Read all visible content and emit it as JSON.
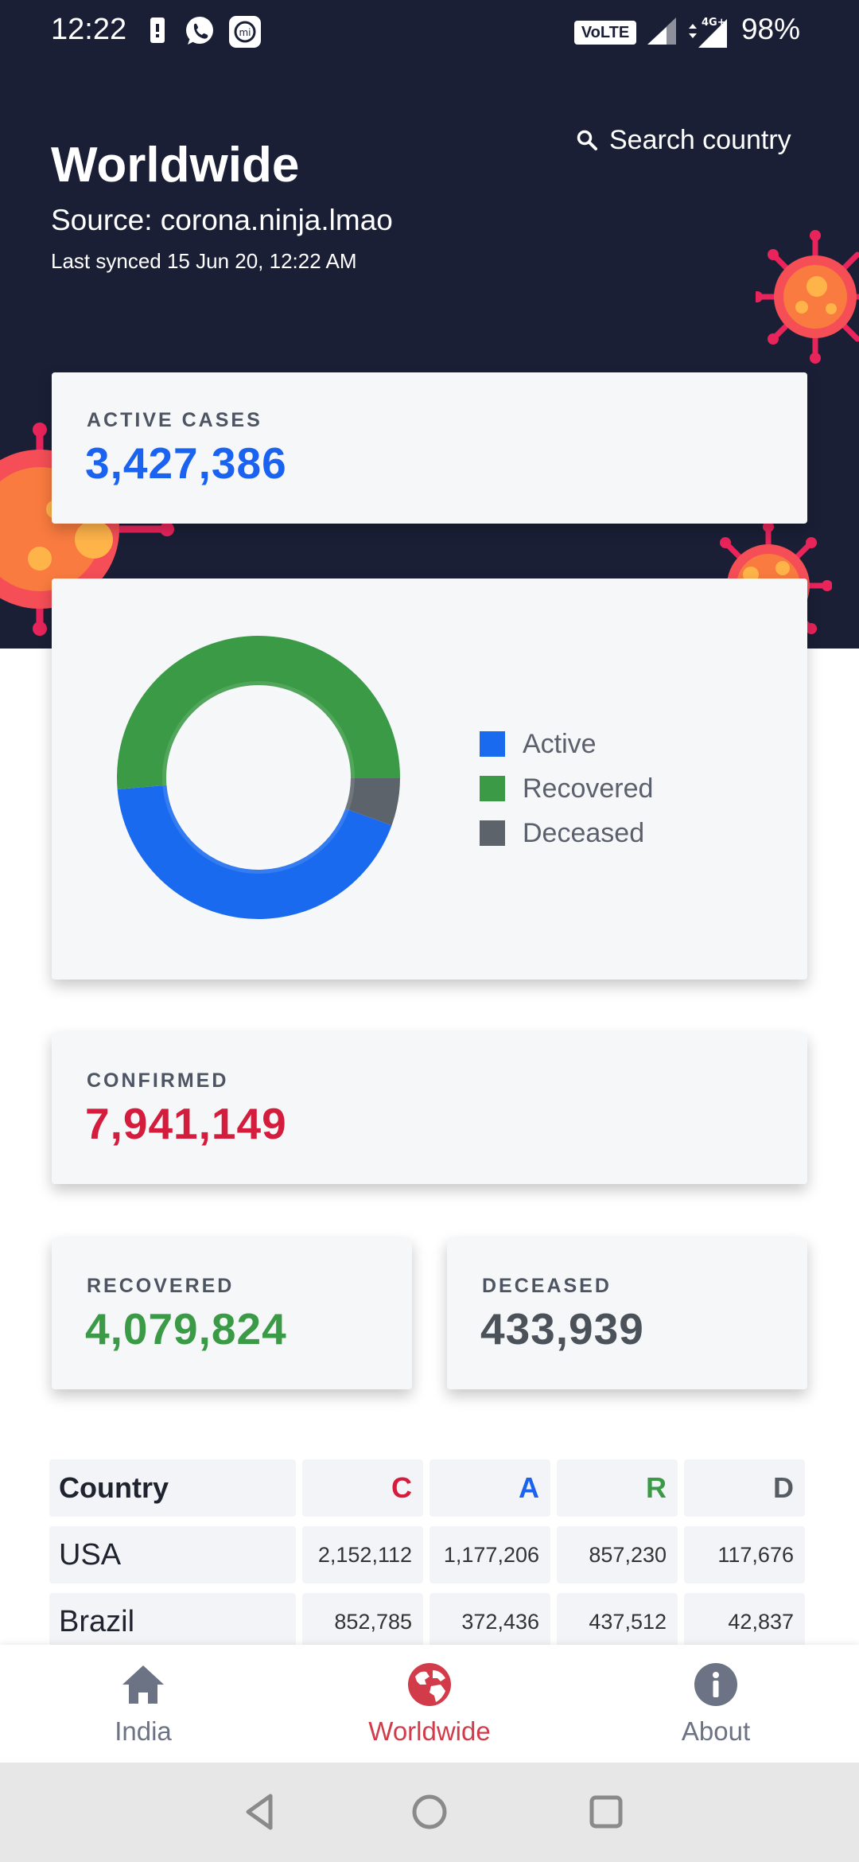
{
  "status_bar": {
    "time": "12:22",
    "network_badge": "VoLTE",
    "network_type": "4G+",
    "battery": "98%"
  },
  "header": {
    "title": "Worldwide",
    "source": "Source: corona.ninja.lmao",
    "last_synced": "Last synced 15 Jun 20, 12:22 AM",
    "search_label": "Search country"
  },
  "active_cases": {
    "label": "ACTIVE CASES",
    "value": "3,427,386",
    "color": "#1a62f0"
  },
  "chart_data": {
    "type": "pie",
    "variant": "donut",
    "categories": [
      "Active",
      "Recovered",
      "Deceased"
    ],
    "values": [
      3427386,
      4079824,
      433939
    ],
    "colors": [
      "#1a6af0",
      "#3a9a45",
      "#5c636b"
    ],
    "legend_position": "right"
  },
  "confirmed": {
    "label": "CONFIRMED",
    "value": "7,941,149",
    "color": "#d41c3d"
  },
  "recovered": {
    "label": "RECOVERED",
    "value": "4,079,824",
    "color": "#3a9a45"
  },
  "deceased": {
    "label": "DECEASED",
    "value": "433,939",
    "color": "#4b5259"
  },
  "table": {
    "headers": [
      {
        "label": "Country",
        "color": "#1f2330"
      },
      {
        "label": "C",
        "color": "#d41c3d"
      },
      {
        "label": "A",
        "color": "#1a62f0"
      },
      {
        "label": "R",
        "color": "#3a9a45"
      },
      {
        "label": "D",
        "color": "#555c63"
      }
    ],
    "rows": [
      {
        "country": "USA",
        "c": "2,152,112",
        "a": "1,177,206",
        "r": "857,230",
        "d": "117,676"
      },
      {
        "country": "Brazil",
        "c": "852,785",
        "a": "372,436",
        "r": "437,512",
        "d": "42,837"
      }
    ]
  },
  "bottom_nav": {
    "items": [
      {
        "label": "India",
        "icon": "home-icon",
        "active": false
      },
      {
        "label": "Worldwide",
        "icon": "globe-icon",
        "active": true
      },
      {
        "label": "About",
        "icon": "info-icon",
        "active": false
      }
    ],
    "active_color": "#d13b4a",
    "inactive_color": "#6b7385"
  },
  "system_nav": {
    "icons": [
      "back-icon",
      "home-circle-icon",
      "recents-icon"
    ]
  }
}
